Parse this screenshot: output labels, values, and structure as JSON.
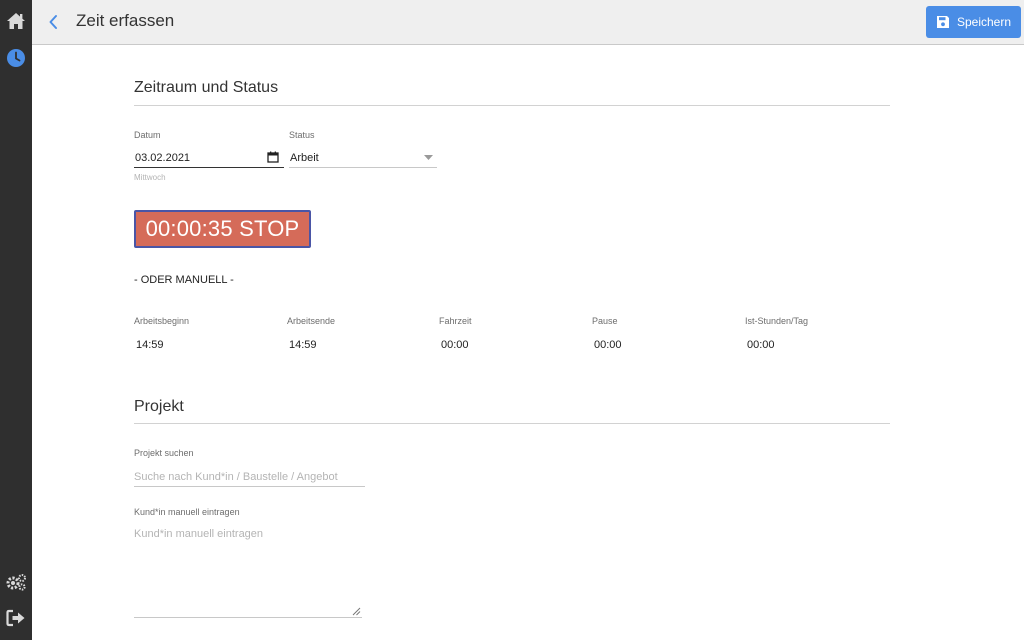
{
  "sidebar": {
    "items": [
      {
        "icon": "home-icon"
      },
      {
        "icon": "clock-icon",
        "active": true
      },
      {
        "icon": "gears-icon"
      },
      {
        "icon": "logout-icon"
      }
    ]
  },
  "header": {
    "title": "Zeit erfassen",
    "save_label": "Speichern"
  },
  "section1": {
    "title": "Zeitraum und Status",
    "date_label": "Datum",
    "date_value": "03.02.2021",
    "date_hint": "Mittwoch",
    "status_label": "Status",
    "status_value": "Arbeit",
    "timer_label": "00:00:35 STOP",
    "oder_label": "- ODER MANUELL -",
    "times": [
      {
        "label": "Arbeitsbeginn",
        "value": "14:59"
      },
      {
        "label": "Arbeitsende",
        "value": "14:59"
      },
      {
        "label": "Fahrzeit",
        "value": "00:00"
      },
      {
        "label": "Pause",
        "value": "00:00"
      },
      {
        "label": "Ist-Stunden/Tag",
        "value": "00:00"
      }
    ]
  },
  "section2": {
    "title": "Projekt",
    "search_label": "Projekt suchen",
    "search_placeholder": "Suche nach Kund*in / Baustelle / Angebot",
    "manual_label": "Kund*in manuell eintragen",
    "manual_placeholder": "Kund*in manuell eintragen"
  },
  "colors": {
    "accent": "#4a8de6",
    "timer": "#d56b59",
    "sidebar": "#2f2f2f"
  }
}
